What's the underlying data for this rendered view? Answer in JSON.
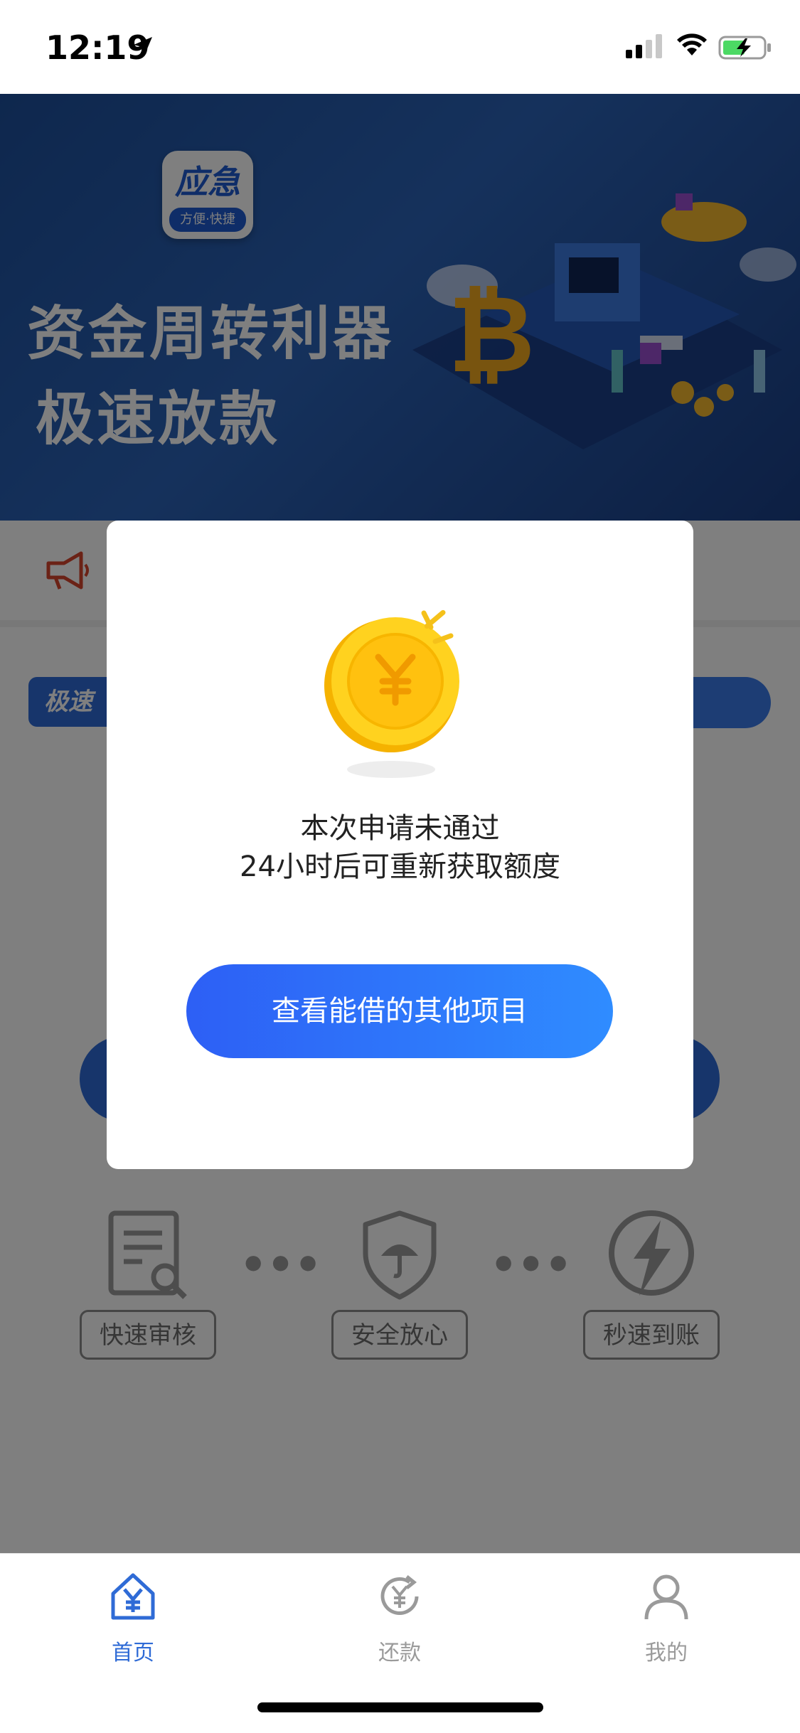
{
  "status_bar": {
    "time": "12:19"
  },
  "banner": {
    "logo_main": "应急",
    "logo_sub": "方便·快捷",
    "headline1": "资金周转利器",
    "headline2": "极速放款"
  },
  "content": {
    "left_tag": "极速",
    "features": [
      {
        "label": "快速审核",
        "icon": "document-search-icon"
      },
      {
        "label": "安全放心",
        "icon": "shield-umbrella-icon"
      },
      {
        "label": "秒速到账",
        "icon": "lightning-icon"
      }
    ]
  },
  "modal": {
    "line1": "本次申请未通过",
    "line2": "24小时后可重新获取额度",
    "button_label": "查看能借的其他项目"
  },
  "tabbar": {
    "active_color": "#2f6bd6",
    "inactive_color": "#9a9a9a",
    "items": [
      {
        "label": "首页",
        "icon": "home-yen-icon"
      },
      {
        "label": "还款",
        "icon": "repay-yen-icon"
      },
      {
        "label": "我的",
        "icon": "user-icon"
      }
    ]
  }
}
